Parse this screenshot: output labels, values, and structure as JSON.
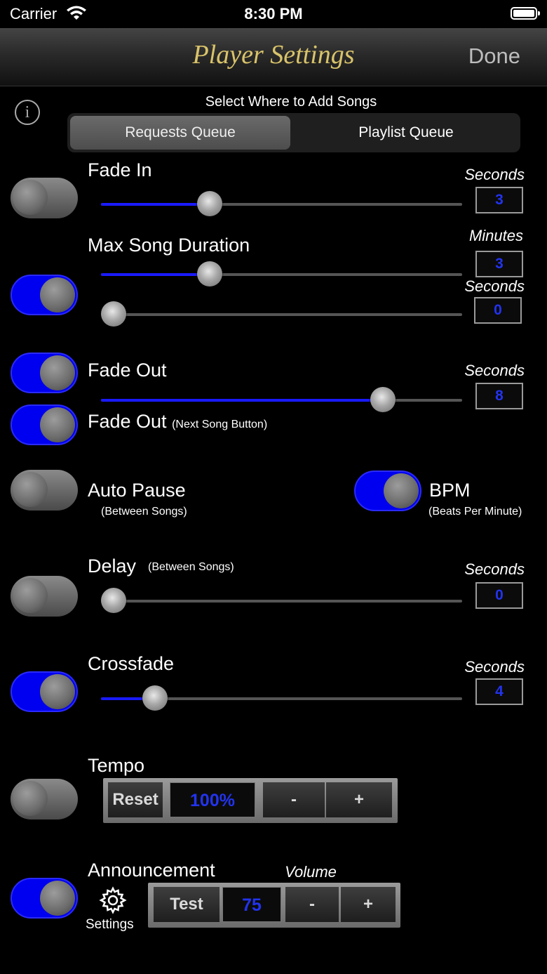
{
  "status": {
    "carrier": "Carrier",
    "time": "8:30 PM"
  },
  "nav": {
    "title": "Player Settings",
    "done": "Done"
  },
  "queue": {
    "label": "Select Where to Add Songs",
    "options": [
      "Requests Queue",
      "Playlist Queue"
    ],
    "selected": "Requests Queue"
  },
  "fade_in": {
    "label": "Fade In",
    "unit": "Seconds",
    "value": "3",
    "enabled": false,
    "slider_fraction": 0.3
  },
  "max_song_duration": {
    "label": "Max Song Duration",
    "enabled": true,
    "minutes": {
      "unit": "Minutes",
      "value": "3",
      "slider_fraction": 0.3
    },
    "seconds": {
      "unit": "Seconds",
      "value": "0",
      "slider_fraction": 0.0
    }
  },
  "fade_out": {
    "label": "Fade Out",
    "unit": "Seconds",
    "value": "8",
    "enabled": true,
    "slider_fraction": 0.78
  },
  "fade_out_next": {
    "label": "Fade Out",
    "note": "(Next Song Button)",
    "enabled": true
  },
  "auto_pause": {
    "label": "Auto Pause",
    "note": "(Between Songs)",
    "enabled": false
  },
  "bpm": {
    "label": "BPM",
    "note": "(Beats Per Minute)",
    "enabled": true
  },
  "delay": {
    "label": "Delay",
    "note": "(Between Songs)",
    "unit": "Seconds",
    "value": "0",
    "enabled": false,
    "slider_fraction": 0.0
  },
  "crossfade": {
    "label": "Crossfade",
    "unit": "Seconds",
    "value": "4",
    "enabled": true,
    "slider_fraction": 0.15
  },
  "tempo": {
    "label": "Tempo",
    "enabled": false,
    "reset": "Reset",
    "value": "100%",
    "minus": "-",
    "plus": "+"
  },
  "announcement": {
    "label": "Announcement",
    "enabled": true,
    "settings": "Settings",
    "volume_label": "Volume",
    "test": "Test",
    "volume": "75",
    "minus": "-",
    "plus": "+"
  },
  "colors": {
    "accent": "#0000f0",
    "title_gold": "#d9c36a",
    "value_blue": "#2233ee"
  },
  "icons": [
    "wifi-icon",
    "battery-icon",
    "info-icon",
    "gear-icon"
  ]
}
